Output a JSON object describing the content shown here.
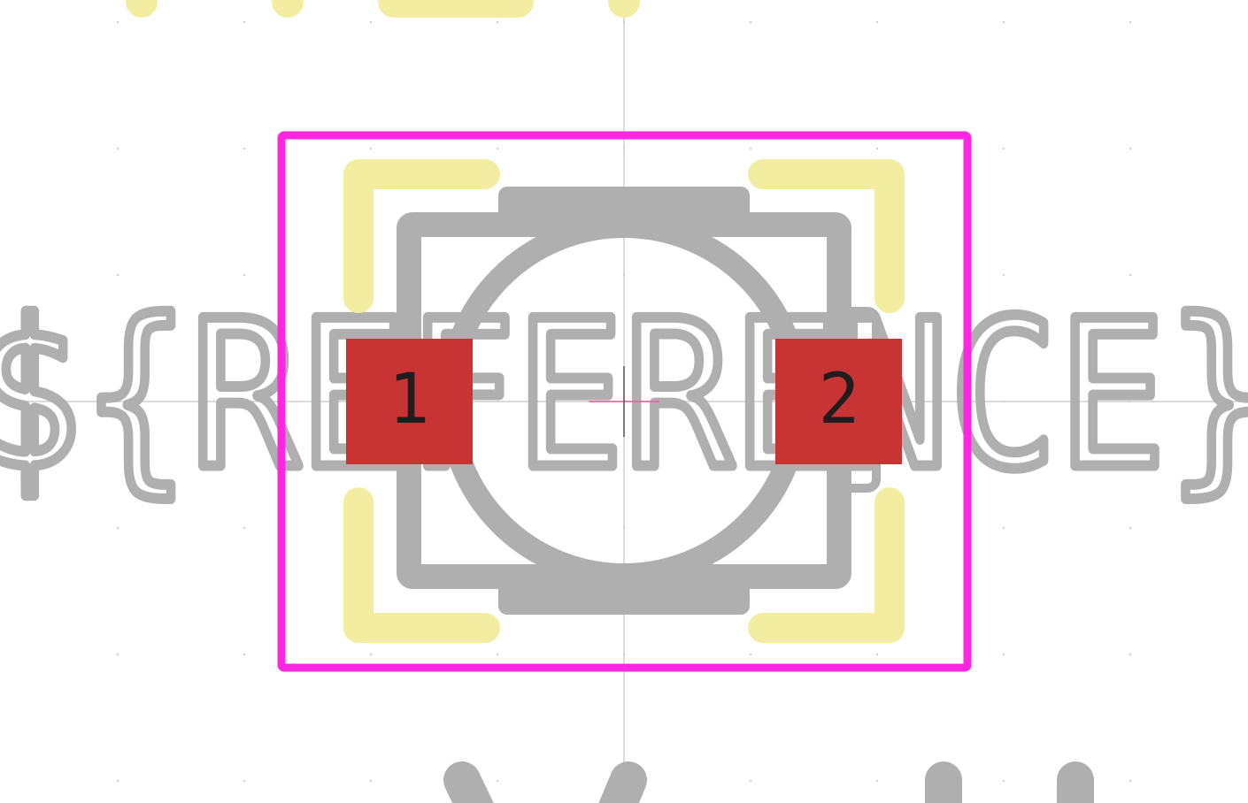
{
  "footprint": {
    "reference_placeholder": "${REFERENCE}",
    "pads": [
      {
        "number": "1",
        "layer": "F.Cu"
      },
      {
        "number": "2",
        "layer": "F.Cu"
      }
    ]
  },
  "colors": {
    "background": "#ffffff",
    "courtyard": "#ff26e2",
    "silkscreen": "#f2eda1",
    "fab": "#afafaf",
    "pad": "#c83434",
    "pad_text": "#1e1e1e",
    "grid": "#d9d9d9",
    "axis": "#c8c8c8"
  }
}
